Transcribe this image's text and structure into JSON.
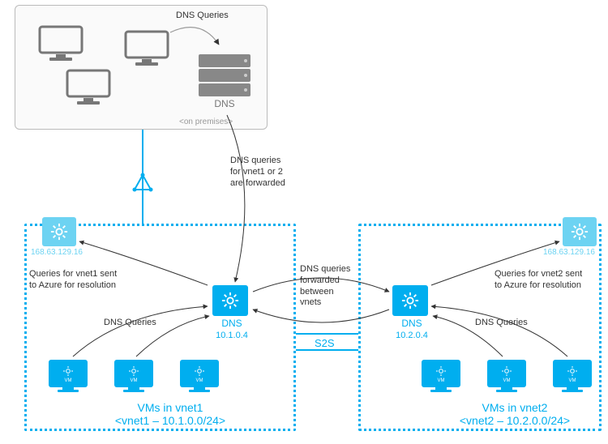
{
  "colors": {
    "accent": "#00aeef",
    "accentLight": "#6dd3f2",
    "gray": "#888"
  },
  "onPremises": {
    "label": "<on premises>",
    "serverLabel": "DNS",
    "dnsQueriesLabel": "DNS Queries"
  },
  "annotations": {
    "forwarded": "DNS queries\nfor vnet1 or 2\nare forwarded",
    "vnet1ToAzure": "Queries for vnet1 sent\nto Azure for resolution",
    "vnet2ToAzure": "Queries for vnet2 sent\nto Azure for resolution",
    "vnet1DnsQueries": "DNS Queries",
    "vnet2DnsQueries": "DNS Queries",
    "betweenVnets": "DNS queries\nforwarded\nbetween\nvnets",
    "s2s": "S2S"
  },
  "vnet1": {
    "azureDnsIp": "168.63.129.16",
    "dnsLabel": "DNS",
    "dnsIp": "10.1.0.4",
    "vmsTitle": "VMs in vnet1",
    "rangeLabel": "<vnet1 – 10.1.0.0/24>"
  },
  "vnet2": {
    "azureDnsIp": "168.63.129.16",
    "dnsLabel": "DNS",
    "dnsIp": "10.2.0.4",
    "vmsTitle": "VMs in vnet2",
    "rangeLabel": "<vnet2 – 10.2.0.0/24>"
  },
  "iconNames": {
    "monitor": "monitor-icon",
    "server": "server-icon",
    "gear": "gear-icon",
    "vm": "vm-icon",
    "triangle": "gateway-triangle-icon"
  }
}
